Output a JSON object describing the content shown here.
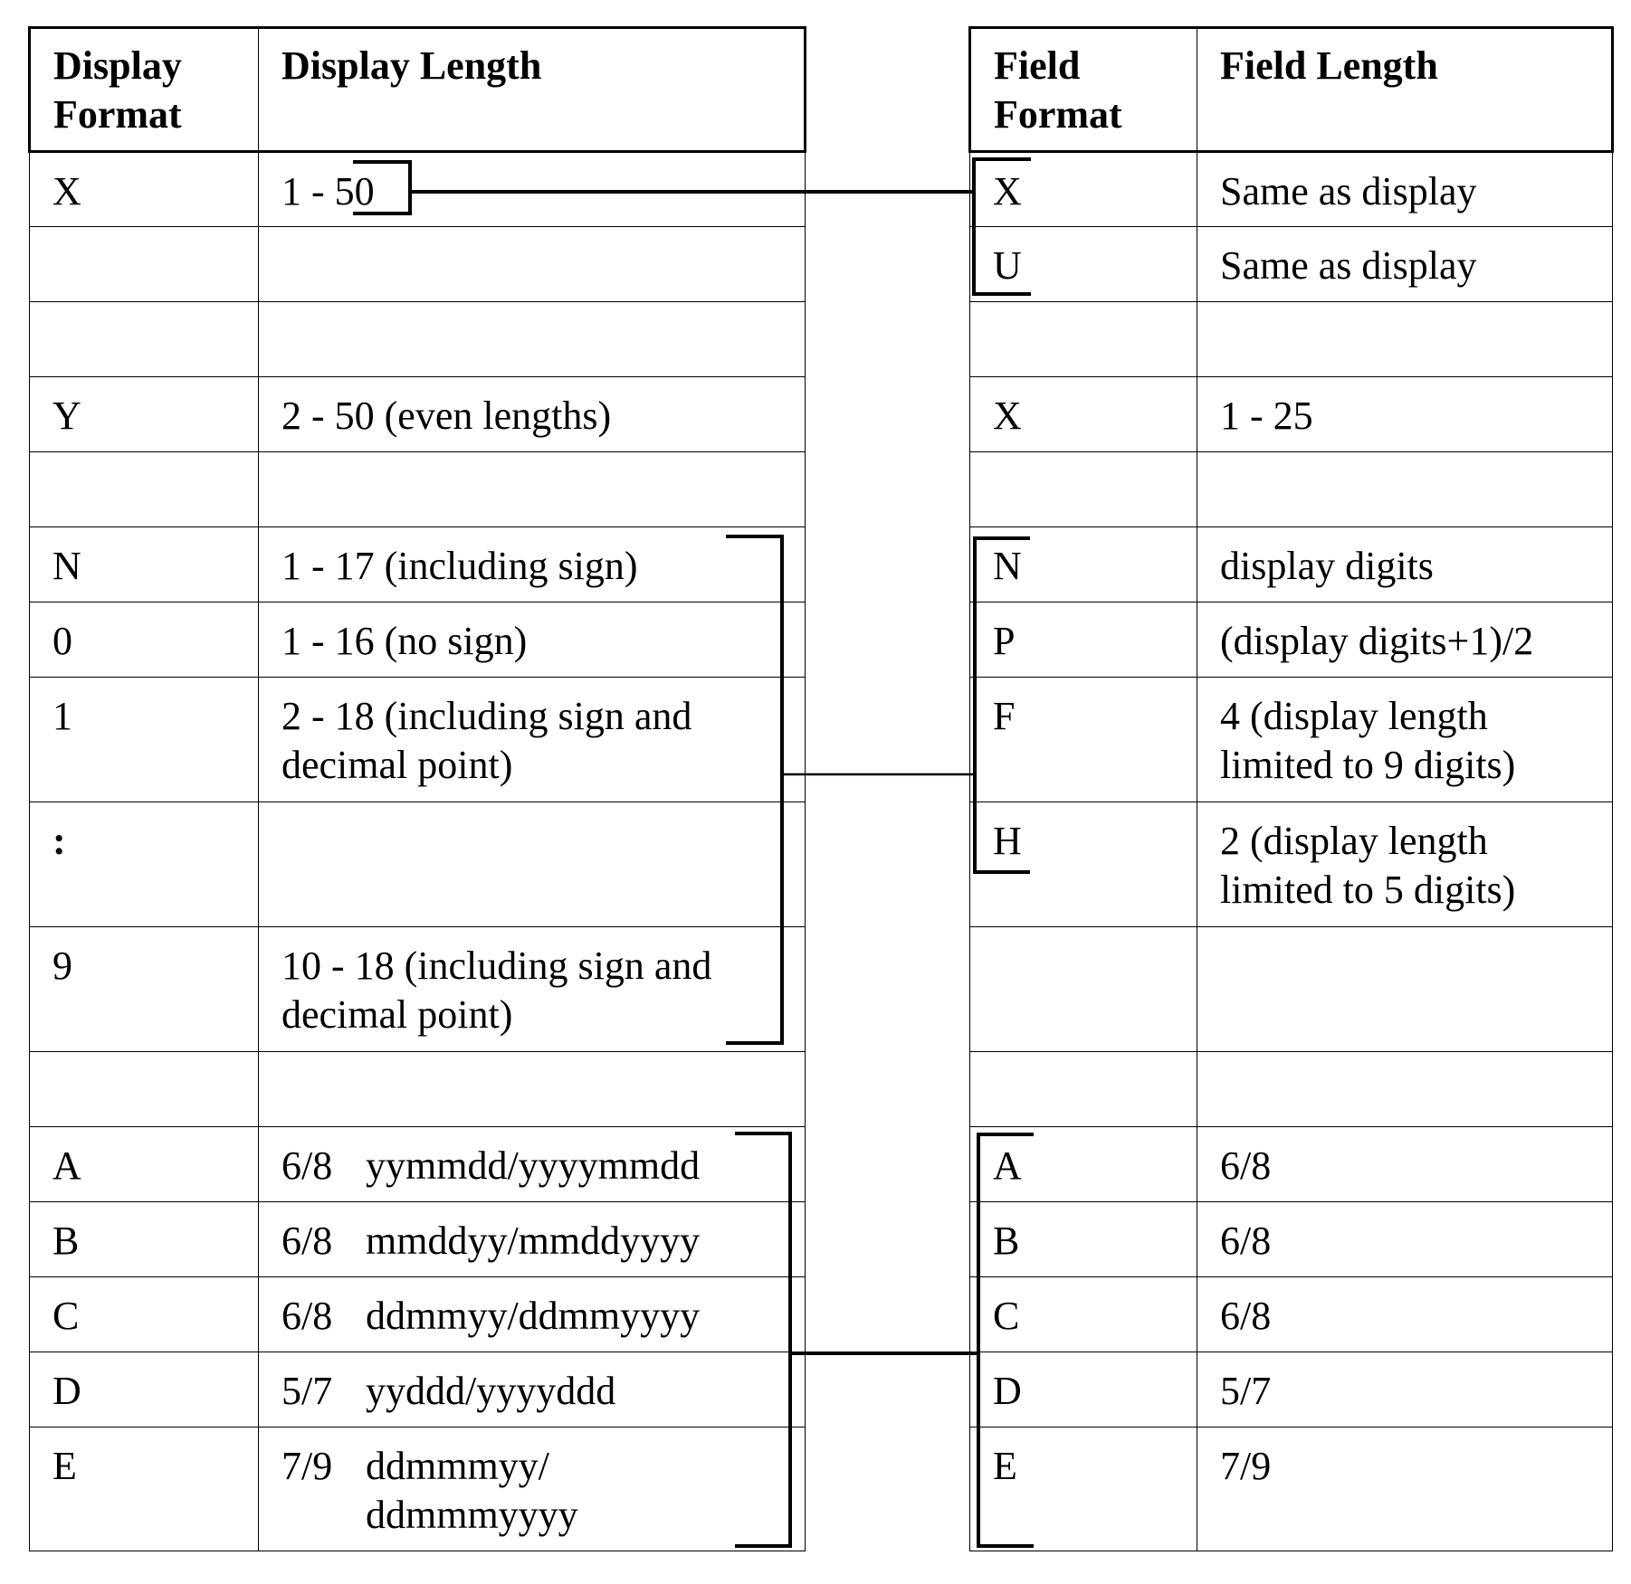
{
  "left_table": {
    "headers": [
      "Display\nFormat",
      "Display Length"
    ],
    "header_lines": [
      [
        "Display",
        "Format"
      ],
      [
        "Display Length"
      ]
    ],
    "rows": [
      {
        "format": "X",
        "length": "1 - 50"
      },
      {
        "format": "",
        "length": ""
      },
      {
        "format": "",
        "length": ""
      },
      {
        "format": "Y",
        "length": "2 - 50 (even lengths)"
      },
      {
        "format": "",
        "length": ""
      },
      {
        "format": "N",
        "length": "1 - 17 (including sign)"
      },
      {
        "format": "0",
        "length": "1 - 16 (no sign)"
      },
      {
        "format": "1",
        "length": "2 - 18 (including sign and decimal point)"
      },
      {
        "format": ":",
        "length": ""
      },
      {
        "format": "9",
        "length": "10 - 18 (including sign and decimal point)"
      },
      {
        "format": "",
        "length": ""
      },
      {
        "format": "A",
        "length_num": "6/8",
        "length_pattern": "yymmdd/yyyymmdd"
      },
      {
        "format": "B",
        "length_num": "6/8",
        "length_pattern": "mmddyy/mmddyyyy"
      },
      {
        "format": "C",
        "length_num": "6/8",
        "length_pattern": "ddmmyy/ddmmyyyy"
      },
      {
        "format": "D",
        "length_num": "5/7",
        "length_pattern": "yyddd/yyyyddd"
      },
      {
        "format": "E",
        "length_num": "7/9",
        "length_pattern": "ddmmmyy/ ddmmmyyyy"
      }
    ]
  },
  "right_table": {
    "header_lines": [
      [
        "Field",
        "Format"
      ],
      [
        "Field Length"
      ]
    ],
    "rows": [
      {
        "format": "X",
        "length": "Same as display"
      },
      {
        "format": "U",
        "length": "Same as display"
      },
      {
        "format": "",
        "length": ""
      },
      {
        "format": "X",
        "length": "1 - 25"
      },
      {
        "format": "",
        "length": ""
      },
      {
        "format": "N",
        "length": "display digits"
      },
      {
        "format": "P",
        "length": "(display digits+1)/2"
      },
      {
        "format": "F",
        "length": "4 (display length limited to 9 digits)"
      },
      {
        "format": "H",
        "length": "2 (display length limited to 5 digits)"
      },
      {
        "format": "",
        "length": ""
      },
      {
        "format": "",
        "length": ""
      },
      {
        "format": "A",
        "length": "6/8"
      },
      {
        "format": "B",
        "length": "6/8"
      },
      {
        "format": "C",
        "length": "6/8"
      },
      {
        "format": "D",
        "length": "5/7"
      },
      {
        "format": "E",
        "length": "7/9"
      }
    ]
  }
}
